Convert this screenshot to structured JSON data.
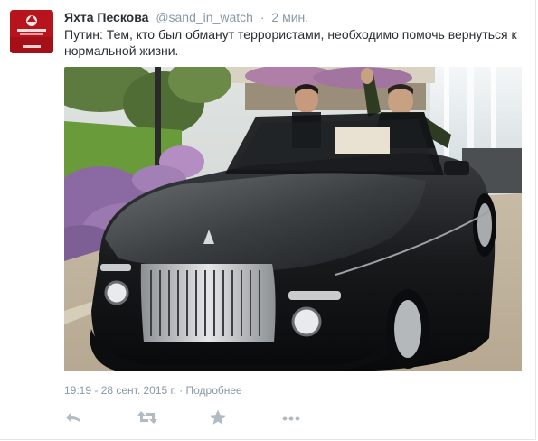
{
  "tweet": {
    "author_name": "Яхта Пескова",
    "handle": "@sand_in_watch",
    "separator": "·",
    "time_ago": "2 мин.",
    "text": "Путин: Тем, кто был обманут террористами, необходимо помочь вернуться к нормальной жизни.",
    "timestamp": "19:19 - 28 сент. 2015 г.",
    "details_link": "Подробнее"
  },
  "avatar": {
    "logo_text": "ЯХТА",
    "caption": "ДМИТРИЙ ПЕСКОВ",
    "amount": "26 000 000"
  },
  "actions": [
    {
      "name": "reply",
      "icon": "reply-icon"
    },
    {
      "name": "retweet",
      "icon": "retweet-icon"
    },
    {
      "name": "favorite",
      "icon": "star-icon"
    },
    {
      "name": "more",
      "icon": "more-dots-icon"
    }
  ],
  "colors": {
    "text": "#292f33",
    "muted": "#8899a6",
    "action_icon": "#b1bbc3",
    "avatar_bg": "#b8141e"
  }
}
